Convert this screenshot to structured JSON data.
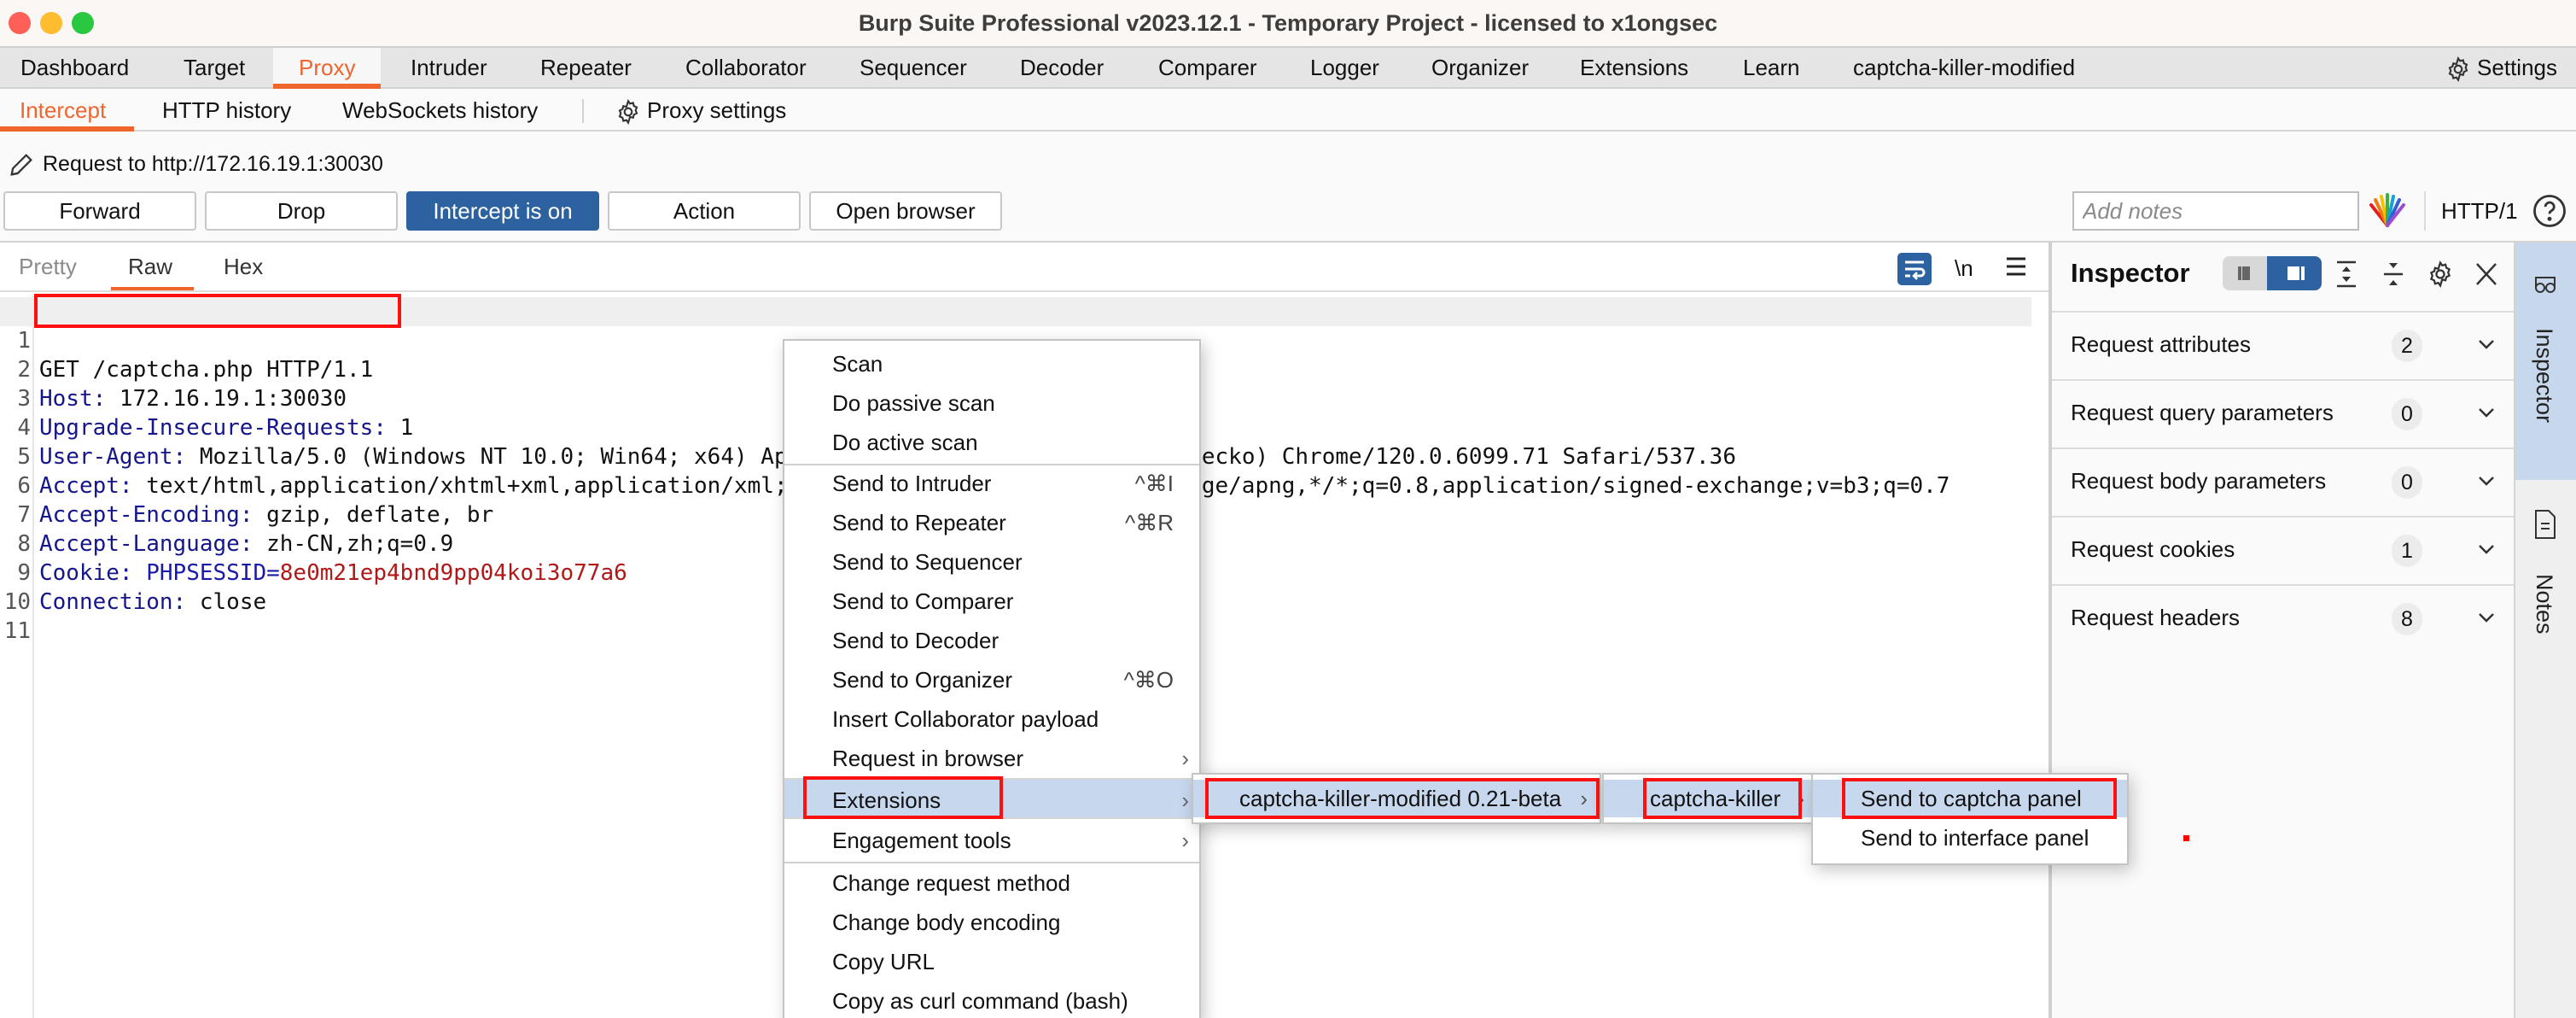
{
  "window": {
    "title": "Burp Suite Professional v2023.12.1 - Temporary Project - licensed to x1ongsec"
  },
  "main_tabs": [
    {
      "label": "Dashboard",
      "active": false
    },
    {
      "label": "Target",
      "active": false
    },
    {
      "label": "Proxy",
      "active": true
    },
    {
      "label": "Intruder",
      "active": false
    },
    {
      "label": "Repeater",
      "active": false
    },
    {
      "label": "Collaborator",
      "active": false
    },
    {
      "label": "Sequencer",
      "active": false
    },
    {
      "label": "Decoder",
      "active": false
    },
    {
      "label": "Comparer",
      "active": false
    },
    {
      "label": "Logger",
      "active": false
    },
    {
      "label": "Organizer",
      "active": false
    },
    {
      "label": "Extensions",
      "active": false
    },
    {
      "label": "Learn",
      "active": false
    },
    {
      "label": "captcha-killer-modified",
      "active": false
    }
  ],
  "settings_label": "Settings",
  "sub_tabs": [
    {
      "label": "Intercept",
      "active": true
    },
    {
      "label": "HTTP history",
      "active": false
    },
    {
      "label": "WebSockets history",
      "active": false
    }
  ],
  "proxy_settings_label": "Proxy settings",
  "request_target": "Request to http://172.16.19.1:30030",
  "toolbar": {
    "forward": "Forward",
    "drop": "Drop",
    "intercept": "Intercept is on",
    "action": "Action",
    "open_browser": "Open browser",
    "notes_placeholder": "Add notes",
    "http_version": "HTTP/1"
  },
  "editor": {
    "tabs": [
      {
        "label": "Pretty",
        "active": false
      },
      {
        "label": "Raw",
        "active": true
      },
      {
        "label": "Hex",
        "active": false
      }
    ],
    "newline_toggle": "\\n",
    "lines": [
      {
        "n": "1",
        "name": "",
        "text": "GET /captcha.php HTTP/1.1"
      },
      {
        "n": "2",
        "name": "Host",
        "text": " 172.16.19.1:30030"
      },
      {
        "n": "3",
        "name": "Upgrade-Insecure-Requests",
        "text": " 1"
      },
      {
        "n": "4",
        "name": "User-Agent",
        "text": " Mozilla/5.0 (Windows NT 10.0; Win64; x64) AppleWebKit/537.36 (KHTML, like Gecko) Chrome/120.0.6099.71 Safari/537.36"
      },
      {
        "n": "5",
        "name": "Accept",
        "text": " text/html,application/xhtml+xml,application/xml;q=0.9,image/avif,image/webp,image/apng,*/*;q=0.8,application/signed-exchange;v=b3;q=0.7"
      },
      {
        "n": "6",
        "name": "Accept-Encoding",
        "text": " gzip, deflate, br"
      },
      {
        "n": "7",
        "name": "Accept-Language",
        "text": " zh-CN,zh;q=0.9"
      },
      {
        "n": "8",
        "name": "Cookie",
        "text": " ",
        "cookie_name": "PHPSESSID",
        "cookie_value": "8e0m21ep4bnd9pp04koi3o77a6"
      },
      {
        "n": "9",
        "name": "Connection",
        "text": " close"
      },
      {
        "n": "10",
        "name": "",
        "text": ""
      },
      {
        "n": "11",
        "name": "",
        "text": ""
      }
    ]
  },
  "inspector": {
    "title": "Inspector",
    "sections": [
      {
        "label": "Request attributes",
        "count": "2"
      },
      {
        "label": "Request query parameters",
        "count": "0"
      },
      {
        "label": "Request body parameters",
        "count": "0"
      },
      {
        "label": "Request cookies",
        "count": "1"
      },
      {
        "label": "Request headers",
        "count": "8"
      }
    ]
  },
  "side_tabs": [
    {
      "label": "Inspector",
      "active": true
    },
    {
      "label": "Notes",
      "active": false
    }
  ],
  "context_menu": {
    "items": [
      {
        "label": "Scan",
        "shortcut": "",
        "submenu": false
      },
      {
        "label": "Do passive scan",
        "shortcut": "",
        "submenu": false
      },
      {
        "label": "Do active scan",
        "shortcut": "",
        "submenu": false
      },
      {
        "label": "Send to Intruder",
        "shortcut": "^⌘I",
        "submenu": false
      },
      {
        "label": "Send to Repeater",
        "shortcut": "^⌘R",
        "submenu": false
      },
      {
        "label": "Send to Sequencer",
        "shortcut": "",
        "submenu": false
      },
      {
        "label": "Send to Comparer",
        "shortcut": "",
        "submenu": false
      },
      {
        "label": "Send to Decoder",
        "shortcut": "",
        "submenu": false
      },
      {
        "label": "Send to Organizer",
        "shortcut": "^⌘O",
        "submenu": false
      },
      {
        "label": "Insert Collaborator payload",
        "shortcut": "",
        "submenu": false
      },
      {
        "label": "Request in browser",
        "shortcut": "",
        "submenu": true
      },
      {
        "label": "Extensions",
        "shortcut": "",
        "submenu": true,
        "highlighted": true
      },
      {
        "label": "Engagement tools",
        "shortcut": "",
        "submenu": true
      },
      {
        "label": "Change request method",
        "shortcut": "",
        "submenu": false
      },
      {
        "label": "Change body encoding",
        "shortcut": "",
        "submenu": false
      },
      {
        "label": "Copy URL",
        "shortcut": "",
        "submenu": false
      },
      {
        "label": "Copy as curl command (bash)",
        "shortcut": "",
        "submenu": false
      }
    ],
    "extensions_submenu": {
      "label": "captcha-killer-modified 0.21-beta"
    },
    "extension_submenu": {
      "label": "captcha-killer"
    },
    "action_submenu": [
      {
        "label": "Send to captcha panel",
        "highlighted": true
      },
      {
        "label": "Send to interface panel",
        "highlighted": false
      }
    ]
  },
  "colors": {
    "accent": "#f0642e",
    "primary_button": "#2d62a0",
    "menu_highlight": "#c7d8ee",
    "annotation_red": "#ff1010"
  }
}
